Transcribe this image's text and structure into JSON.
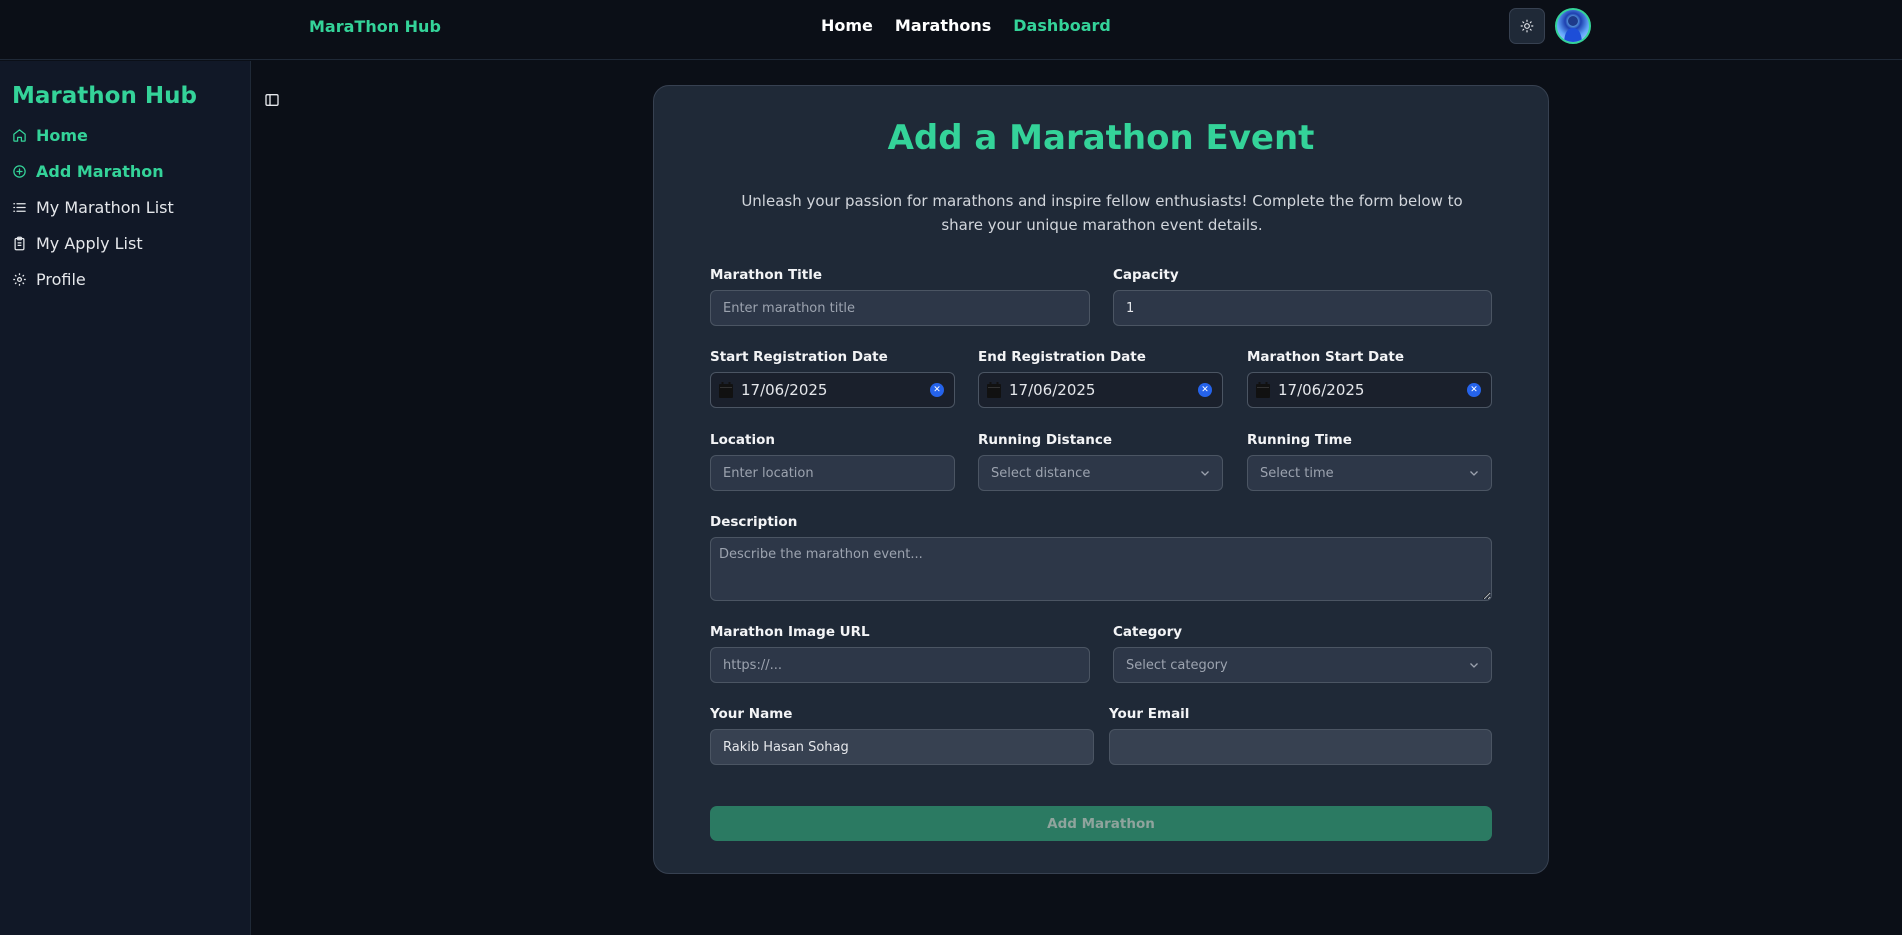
{
  "topbar": {
    "brand": "MaraThon Hub",
    "nav": [
      "Home",
      "Marathons",
      "Dashboard"
    ],
    "active_nav": "Dashboard",
    "theme_icon": "sun-icon",
    "avatar_icon": "user-avatar"
  },
  "sidebar": {
    "title": "Marathon Hub",
    "items": [
      {
        "label": "Home",
        "icon": "home-icon"
      },
      {
        "label": "Add Marathon",
        "icon": "plus-circle-icon"
      },
      {
        "label": "My Marathon List",
        "icon": "list-icon"
      },
      {
        "label": "My Apply List",
        "icon": "clipboard-icon"
      },
      {
        "label": "Profile",
        "icon": "gear-icon"
      }
    ],
    "toggle_icon": "sidebar-toggle-icon"
  },
  "form": {
    "title": "Add a Marathon Event",
    "subtitle": "Unleash your passion for marathons and inspire fellow enthusiasts! Complete the form below to share your unique marathon event details.",
    "marathon_title": {
      "label": "Marathon Title",
      "placeholder": "Enter marathon title"
    },
    "capacity": {
      "label": "Capacity",
      "value": "1"
    },
    "start_registration": {
      "label": "Start Registration Date",
      "value": "17/06/2025"
    },
    "end_registration": {
      "label": "End Registration Date",
      "value": "17/06/2025"
    },
    "marathon_start": {
      "label": "Marathon Start Date",
      "value": "17/06/2025"
    },
    "location": {
      "label": "Location",
      "placeholder": "Enter location"
    },
    "running_distance": {
      "label": "Running Distance",
      "selected": "Select distance"
    },
    "running_time": {
      "label": "Running Time",
      "selected": "Select time"
    },
    "description": {
      "label": "Description",
      "placeholder": "Describe the marathon event..."
    },
    "image_url": {
      "label": "Marathon Image URL",
      "placeholder": "https://..."
    },
    "category": {
      "label": "Category",
      "selected": "Select category"
    },
    "your_name": {
      "label": "Your Name",
      "value": "Rakib Hasan Sohag"
    },
    "your_email": {
      "label": "Your Email",
      "value": ""
    },
    "submit_label": "Add Marathon"
  },
  "colors": {
    "accent": "#34d399",
    "background": "#0b0f17",
    "card": "#1f2937",
    "button": "#2b7a62"
  }
}
